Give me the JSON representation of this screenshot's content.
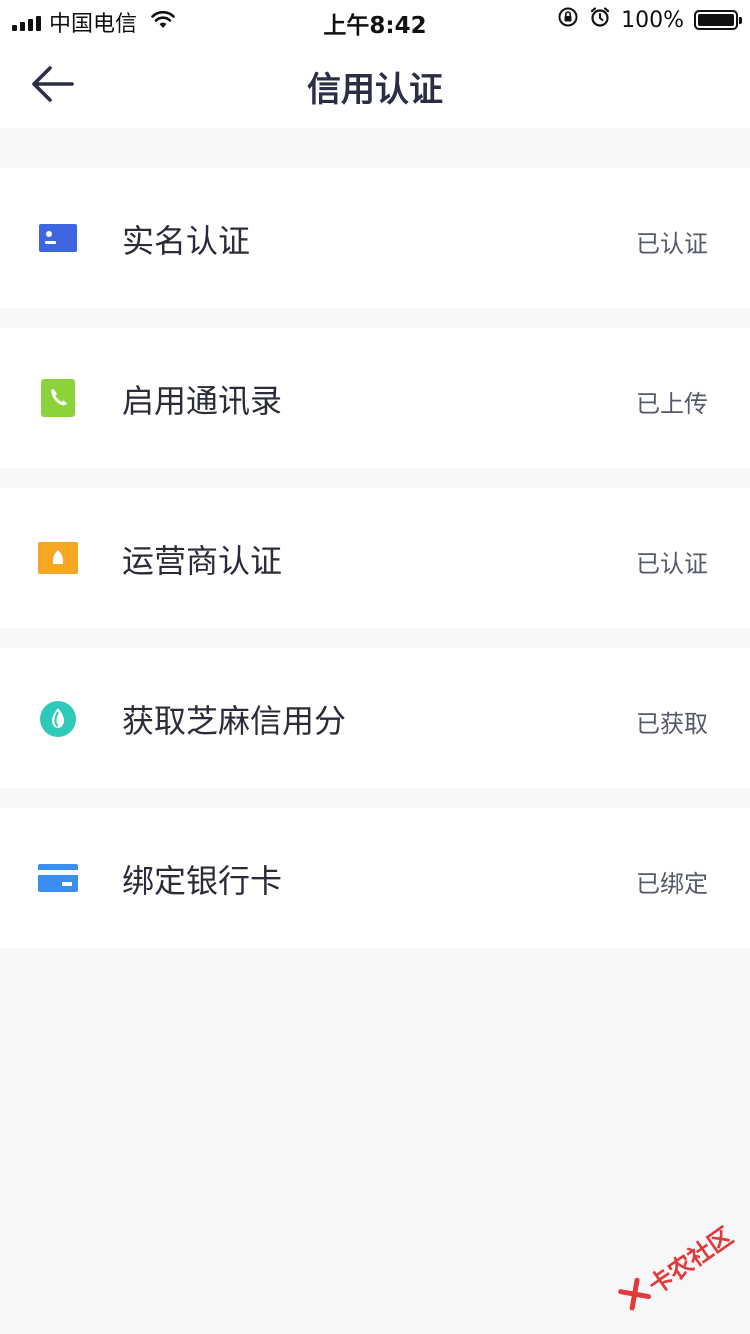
{
  "status_bar": {
    "carrier": "中国电信",
    "time": "上午8:42",
    "battery": "100%"
  },
  "nav": {
    "title": "信用认证"
  },
  "items": [
    {
      "label": "实名认证",
      "status": "已认证",
      "icon": "id-card-icon",
      "color": "#3e66e0"
    },
    {
      "label": "启用通讯录",
      "status": "已上传",
      "icon": "phone-book-icon",
      "color": "#8cd23a"
    },
    {
      "label": "运营商认证",
      "status": "已认证",
      "icon": "carrier-icon",
      "color": "#f5a623"
    },
    {
      "label": "获取芝麻信用分",
      "status": "已获取",
      "icon": "sesame-credit-icon",
      "color": "#2ec9b8"
    },
    {
      "label": "绑定银行卡",
      "status": "已绑定",
      "icon": "bank-card-icon",
      "color": "#3a8ef0"
    }
  ],
  "watermark": {
    "text": "卡农社区"
  }
}
